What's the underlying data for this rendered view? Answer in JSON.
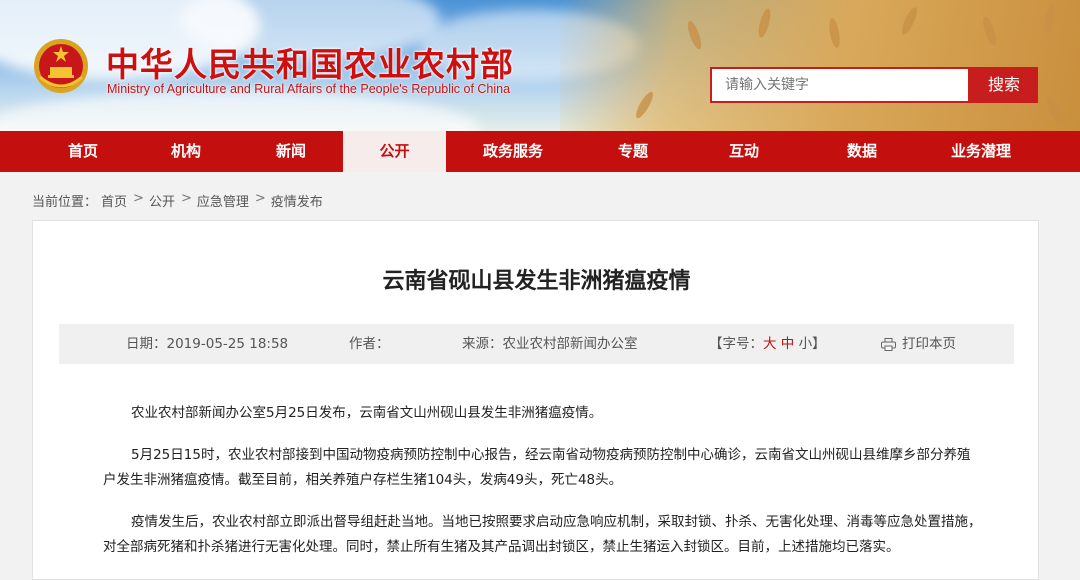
{
  "header": {
    "title_cn": "中华人民共和国农业农村部",
    "title_en": "Ministry of Agriculture and Rural Affairs of the People's Republic of China",
    "emblem_icon": "national-emblem-icon",
    "search": {
      "placeholder": "请输入关键字",
      "button": "搜索"
    }
  },
  "nav": {
    "items": [
      {
        "label": "首页",
        "active": false
      },
      {
        "label": "机构",
        "active": false
      },
      {
        "label": "新闻",
        "active": false
      },
      {
        "label": "公开",
        "active": true
      },
      {
        "label": "政务服务",
        "active": false
      },
      {
        "label": "专题",
        "active": false
      },
      {
        "label": "互动",
        "active": false
      },
      {
        "label": "数据",
        "active": false
      },
      {
        "label": "业务潜理",
        "active": false
      }
    ]
  },
  "breadcrumb": {
    "prefix": "当前位置：",
    "items": [
      "首页",
      "公开",
      "应急管理",
      "疫情发布"
    ],
    "separator": ">"
  },
  "article": {
    "title": "云南省砚山县发生非洲猪瘟疫情",
    "meta": {
      "date": "日期：2019-05-25 18:58",
      "author": "作者：",
      "source": "来源：农业农村部新闻办公室",
      "font_size_prefix": "【字号：",
      "font_large": "大",
      "font_medium": "中",
      "font_small": "小",
      "font_size_suffix": "】",
      "print": "打印本页"
    },
    "paragraphs": [
      "农业农村部新闻办公室5月25日发布，云南省文山州砚山县发生非洲猪瘟疫情。",
      "5月25日15时，农业农村部接到中国动物疫病预防控制中心报告，经云南省动物疫病预防控制中心确诊，云南省文山州砚山县维摩乡部分养殖户发生非洲猪瘟疫情。截至目前，相关养殖户存栏生猪104头，发病49头，死亡48头。",
      "疫情发生后，农业农村部立即派出督导组赶赴当地。当地已按照要求启动应急响应机制，采取封锁、扑杀、无害化处理、消毒等应急处置措施，对全部病死猪和扑杀猪进行无害化处理。同时，禁止所有生猪及其产品调出封锁区，禁止生猪运入封锁区。目前，上述措施均已落实。"
    ]
  },
  "colors": {
    "brand_red": "#c40f0f",
    "nav_active_bg": "#f6ecec",
    "meta_bg": "#f0f0f0"
  }
}
